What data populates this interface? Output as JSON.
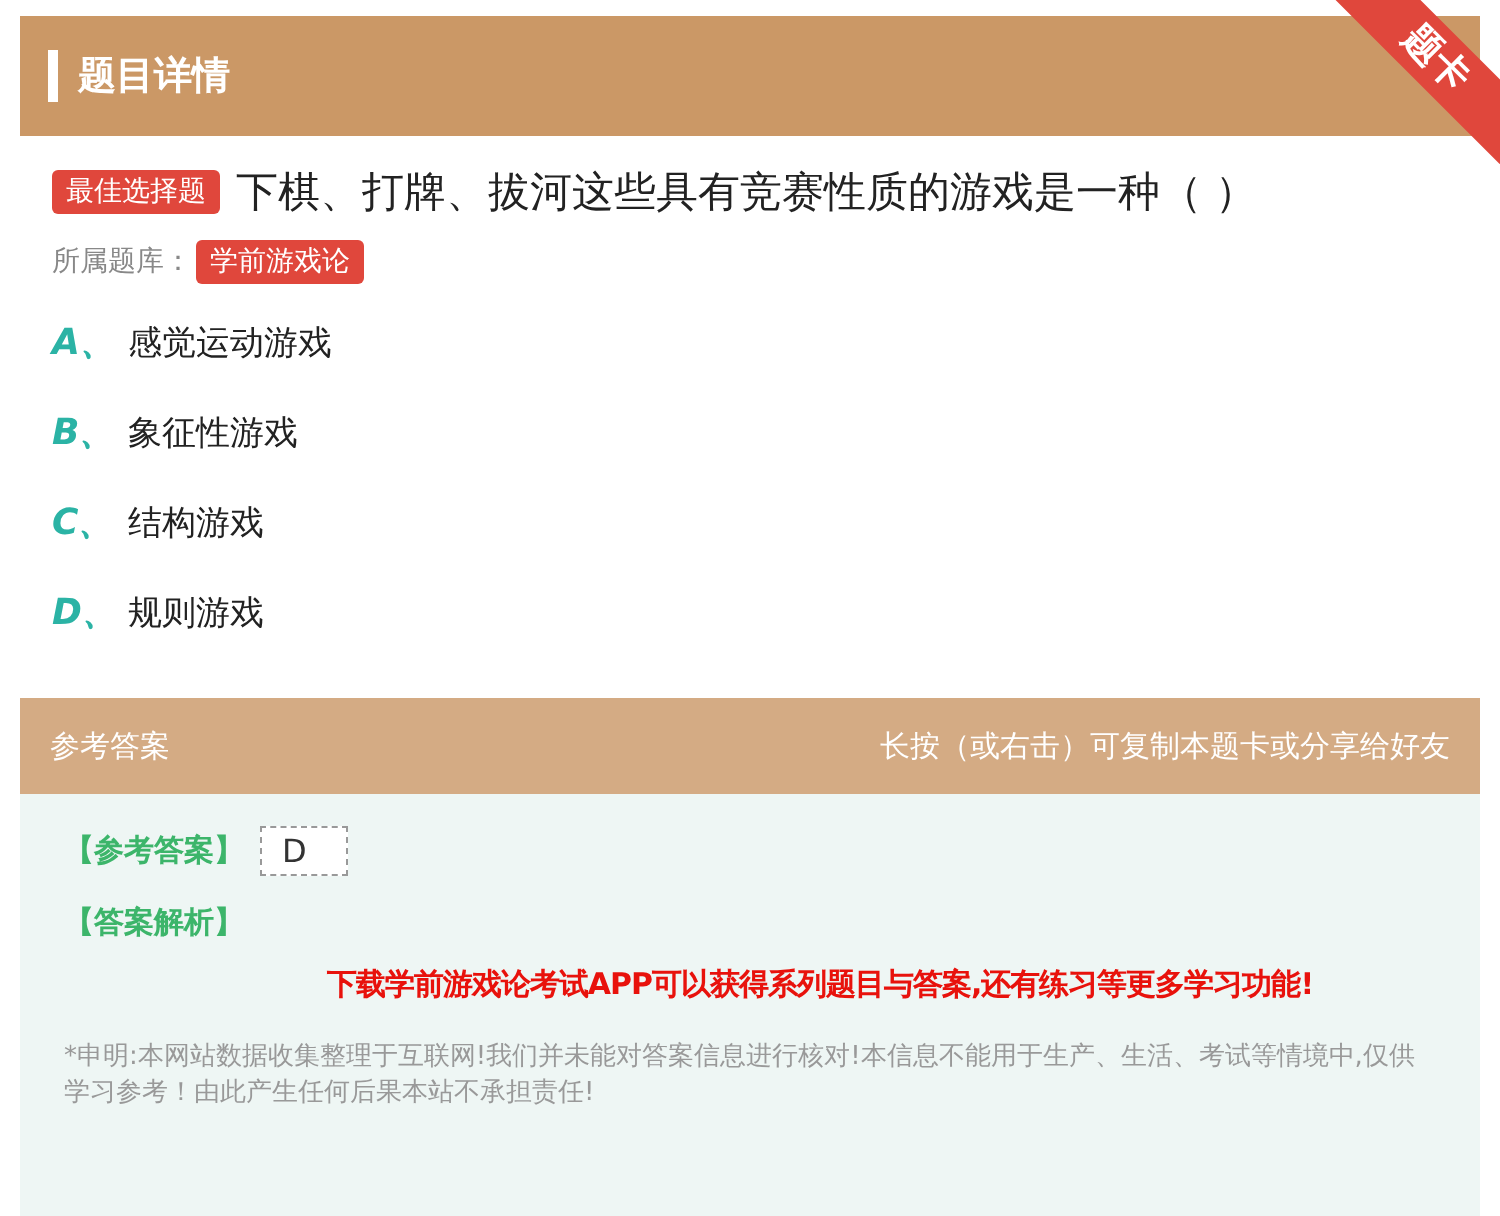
{
  "header": {
    "title": "题目详情",
    "ribbon": "题卡"
  },
  "question": {
    "type_badge": "最佳选择题",
    "text": "下棋、打牌、拔河这些具有竞赛性质的游戏是一种（ ）",
    "bank_label": "所属题库：",
    "bank": "学前游戏论"
  },
  "options": [
    {
      "letter": "A、",
      "text": "感觉运动游戏"
    },
    {
      "letter": "B、",
      "text": "象征性游戏"
    },
    {
      "letter": "C、",
      "text": "结构游戏"
    },
    {
      "letter": "D、",
      "text": "规则游戏"
    }
  ],
  "answer_bar": {
    "title": "参考答案",
    "hint": "长按（或右击）可复制本题卡或分享给好友"
  },
  "answer": {
    "label": "【参考答案】",
    "value": "D",
    "analysis_label": "【答案解析】",
    "promo": "下载学前游戏论考试APP可以获得系列题目与答案,还有练习等更多学习功能!",
    "disclaimer": "*申明:本网站数据收集整理于互联网!我们并未能对答案信息进行核对!本信息不能用于生产、生活、考试等情境中,仅供学习参考！由此产生任何后果本站不承担责任!"
  }
}
